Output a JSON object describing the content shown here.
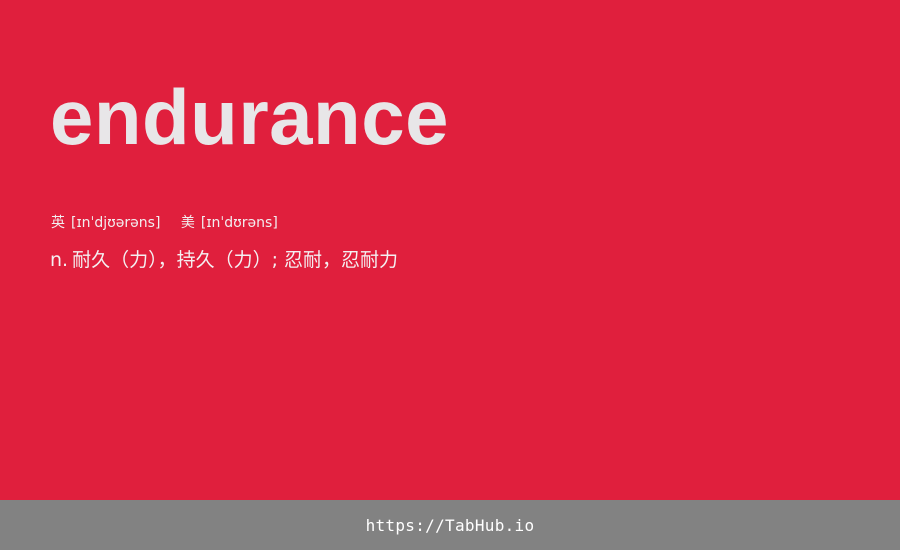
{
  "entry": {
    "word": "endurance",
    "phonetics": {
      "uk_label": "英",
      "uk_ipa": "[ɪnˈdjʊərəns]",
      "us_label": "美",
      "us_ipa": "[ɪnˈdʊrəns]"
    },
    "definition": {
      "part_of_speech": "n.",
      "meaning": "耐久（力），持久（力）; 忍耐，忍耐力"
    }
  },
  "footer": {
    "link_text": "https://TabHub.io"
  },
  "colors": {
    "background": "#e01f3d",
    "footer_background": "#828282",
    "word_text": "#e8e6e8"
  }
}
